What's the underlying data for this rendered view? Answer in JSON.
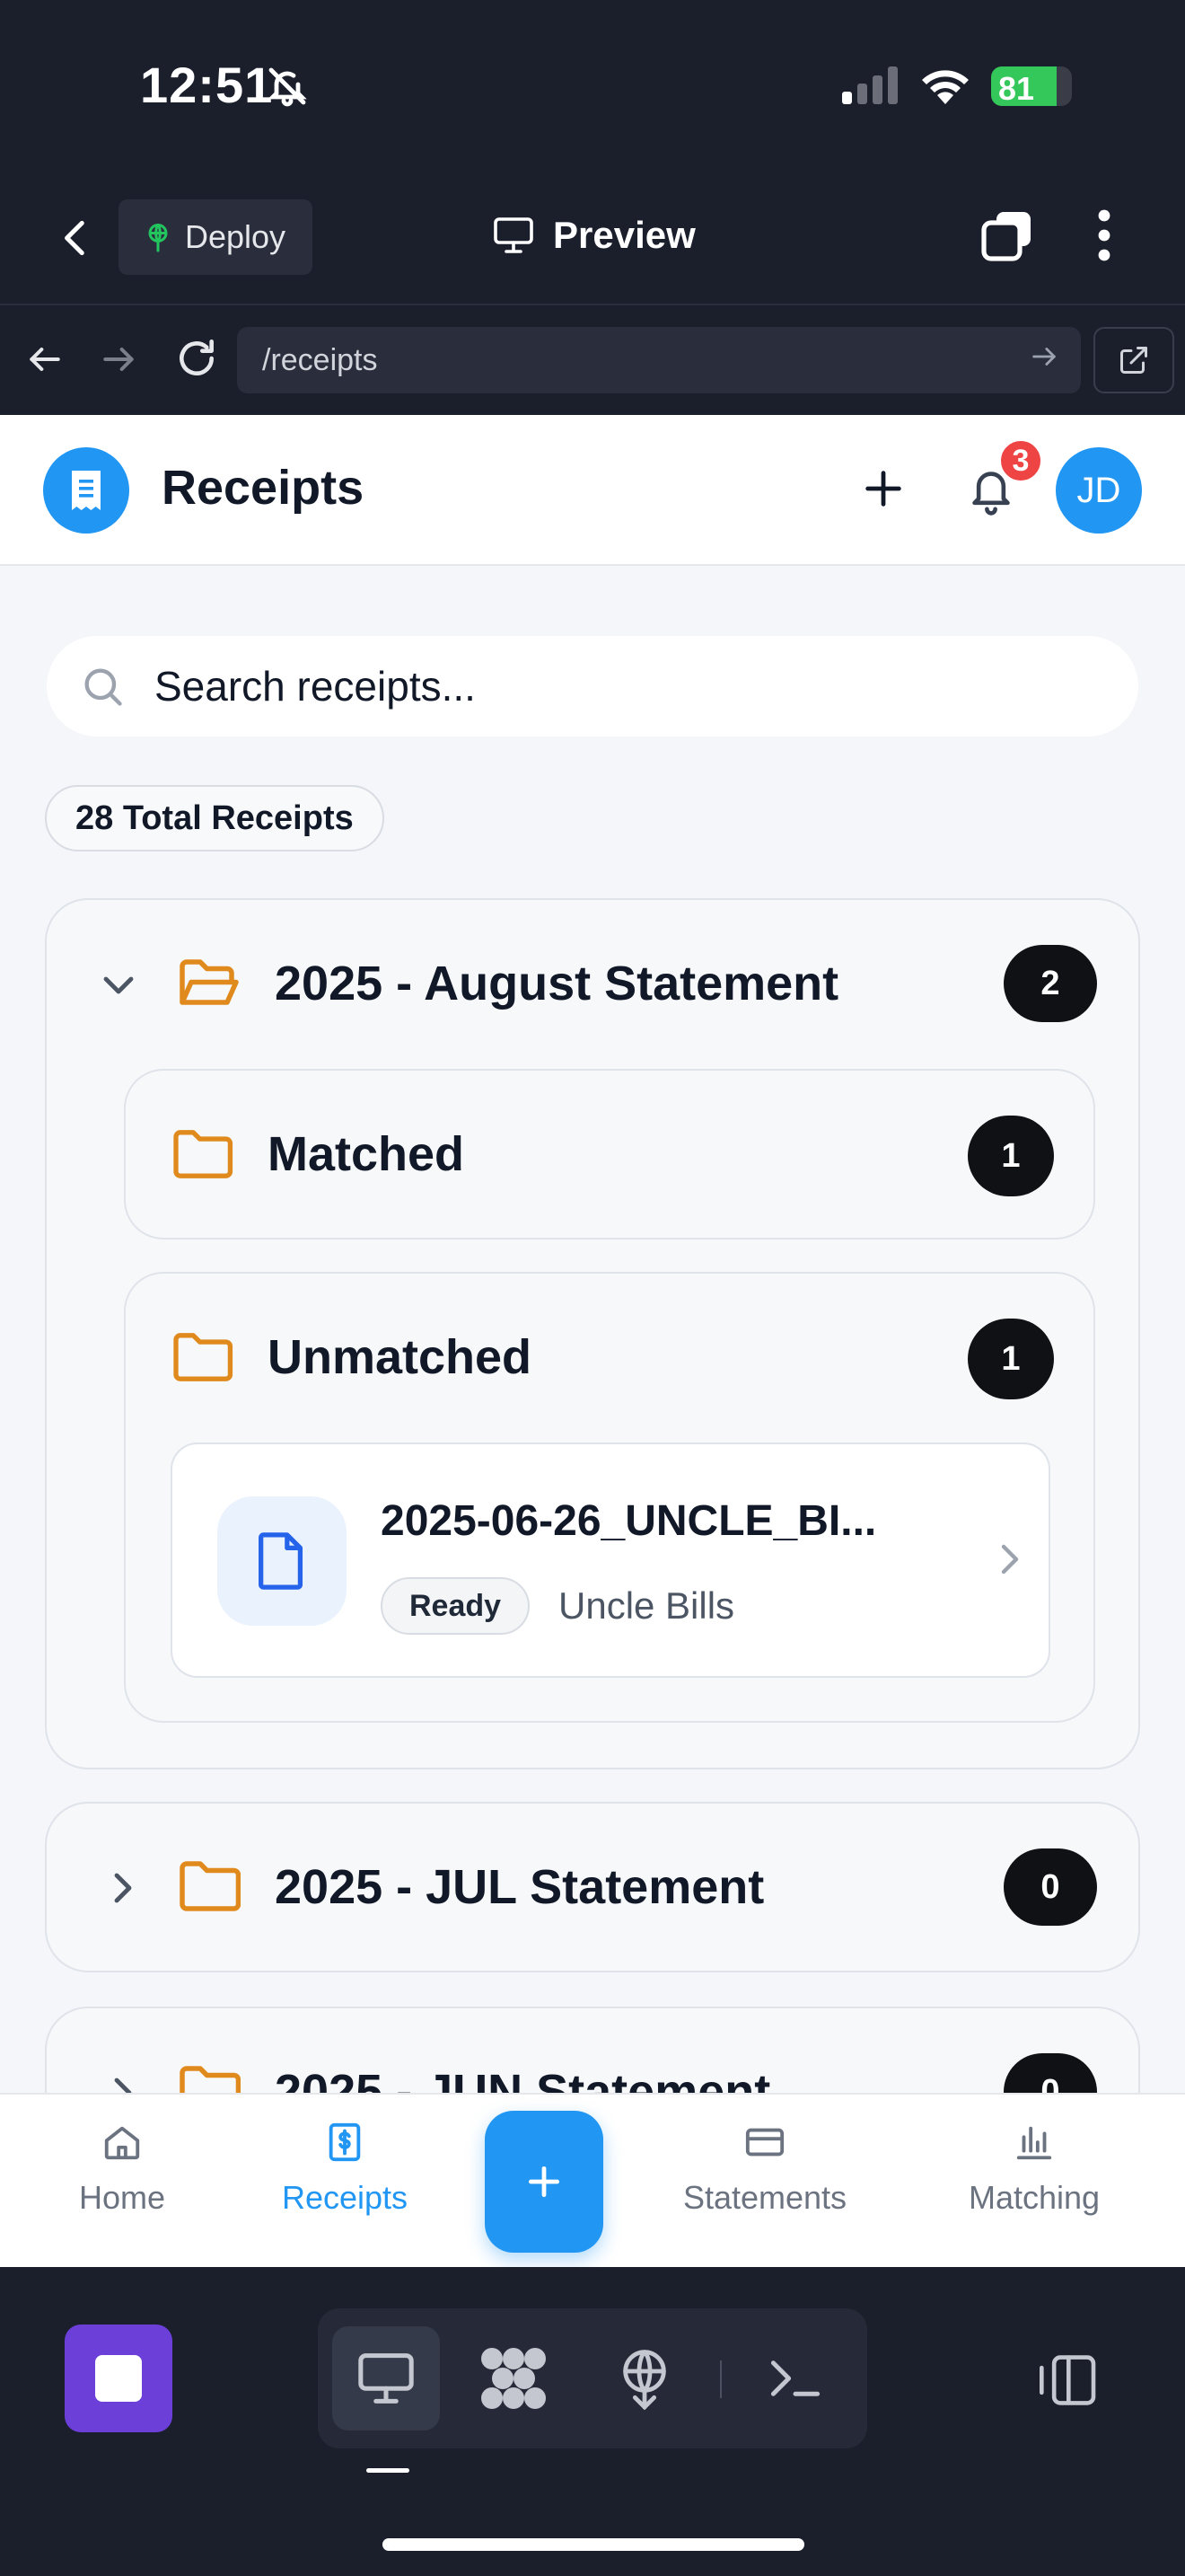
{
  "status_bar": {
    "time": "12:51",
    "battery": "81",
    "battery_level": 0.81
  },
  "app_toolbar": {
    "deploy_label": "Deploy",
    "preview_label": "Preview"
  },
  "browser": {
    "url": "/receipts"
  },
  "header": {
    "title": "Receipts",
    "notification_count": "3",
    "avatar_initials": "JD"
  },
  "search": {
    "placeholder": "Search receipts..."
  },
  "summary": {
    "total_label": "28 Total Receipts"
  },
  "groups": [
    {
      "title": "2025 - August Statement",
      "count": "2",
      "expanded": true,
      "subgroups": [
        {
          "title": "Matched",
          "count": "1"
        },
        {
          "title": "Unmatched",
          "count": "1",
          "items": [
            {
              "name": "2025-06-26_UNCLE_BI...",
              "status": "Ready",
              "vendor": "Uncle Bills"
            }
          ]
        }
      ]
    },
    {
      "title": "2025 - JUL Statement",
      "count": "0",
      "expanded": false
    },
    {
      "title": "2025 - JUN Statement",
      "count": "0",
      "expanded": false
    }
  ],
  "tabbar": {
    "tabs": [
      {
        "label": "Home",
        "icon": "home-icon",
        "active": false
      },
      {
        "label": "Receipts",
        "icon": "dollar-receipt-icon",
        "active": true
      },
      {
        "label": "Statements",
        "icon": "card-icon",
        "active": false
      },
      {
        "label": "Matching",
        "icon": "bar-chart-icon",
        "active": false
      }
    ]
  },
  "colors": {
    "accent": "#2196f3",
    "folder": "#e08a1e",
    "badge_dark": "#0f1115",
    "notification": "#ef4444",
    "dock_stop": "#6d3fd9"
  }
}
